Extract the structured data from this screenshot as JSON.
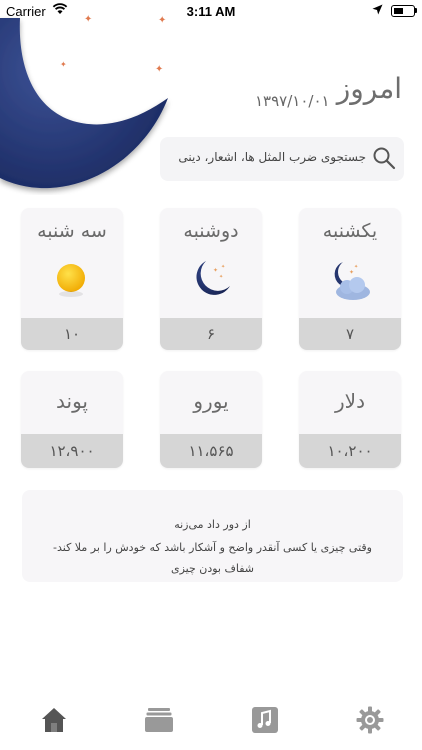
{
  "status_bar": {
    "carrier": "Carrier",
    "time": "3:11 AM"
  },
  "header": {
    "title": "امروز",
    "date": "۱۳۹۷/۱۰/۰۱"
  },
  "search": {
    "placeholder": "جستجوی ضرب المثل ها، اشعار، دینی"
  },
  "days": [
    {
      "name": "یکشنبه",
      "value": "۷",
      "icon": "moon-cloud-icon"
    },
    {
      "name": "دوشنبه",
      "value": "۶",
      "icon": "moon-stars-icon"
    },
    {
      "name": "سه شنبه",
      "value": "۱۰",
      "icon": "sun-icon"
    }
  ],
  "currencies": [
    {
      "name": "دلار",
      "value": "۱۰،۲۰۰"
    },
    {
      "name": "یورو",
      "value": "۱۱،۵۶۵"
    },
    {
      "name": "پوند",
      "value": "۱۲،۹۰۰"
    }
  ],
  "proverb": {
    "title": "از دور داد می‌زنه",
    "line1": "وقتی چیزی یا کسی آنقدر واضح و آشکار باشد که خودش را بر ملا کند-",
    "line2": "شفاف بودن چیزی"
  },
  "tabbar": {
    "items": [
      "home-icon",
      "cards-icon",
      "music-icon",
      "settings-icon"
    ]
  },
  "colors": {
    "moon": "#2c3f7a",
    "card_bg": "#f7f6f8",
    "value_bar": "#d6d6d6",
    "sun": "#f4c400"
  }
}
